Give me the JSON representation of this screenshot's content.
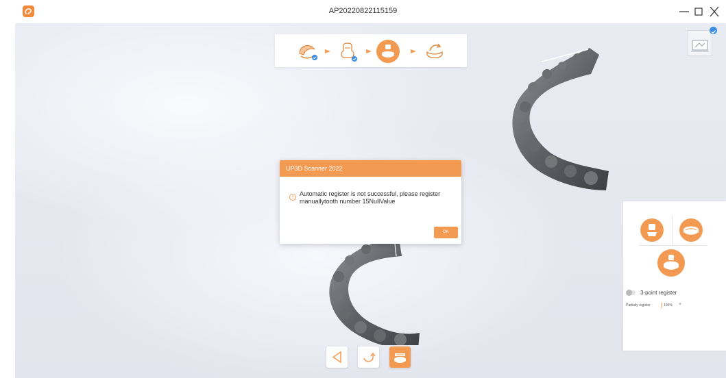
{
  "window": {
    "title": "AP20220822115159",
    "logo_icon": "app-logo-icon",
    "controls": [
      "minimize-icon",
      "maximize-icon",
      "close-icon"
    ]
  },
  "steps": [
    {
      "name": "scan-jaw",
      "icon": "jaw-scan-icon",
      "status": "done"
    },
    {
      "name": "scan-model",
      "icon": "model-scan-icon",
      "status": "done"
    },
    {
      "name": "register",
      "icon": "register-icon",
      "status": "active"
    },
    {
      "name": "process",
      "icon": "process-icon",
      "status": "pending"
    }
  ],
  "dialog": {
    "title": "UP3D Scanner 2022",
    "message": "Automatic register is not successful, please register manuallytooth number 15NullValue",
    "ok_label": "OK",
    "icon": "warning-icon"
  },
  "panel": {
    "buttons": [
      "register-upper-icon",
      "register-lower-icon",
      "register-combined-icon"
    ],
    "three_point_label": "3-point register",
    "three_point_enabled": false,
    "partially_label": "Partially register",
    "partially_value": "100%",
    "plus_label": "+"
  },
  "bottom_toolbar": [
    "back-icon",
    "undo-icon",
    "register-model-icon"
  ],
  "colors": {
    "accent": "#f39a52",
    "logo": "#f08a3c",
    "check": "#3a8de3",
    "scene_bg": "#e6e8ef"
  }
}
